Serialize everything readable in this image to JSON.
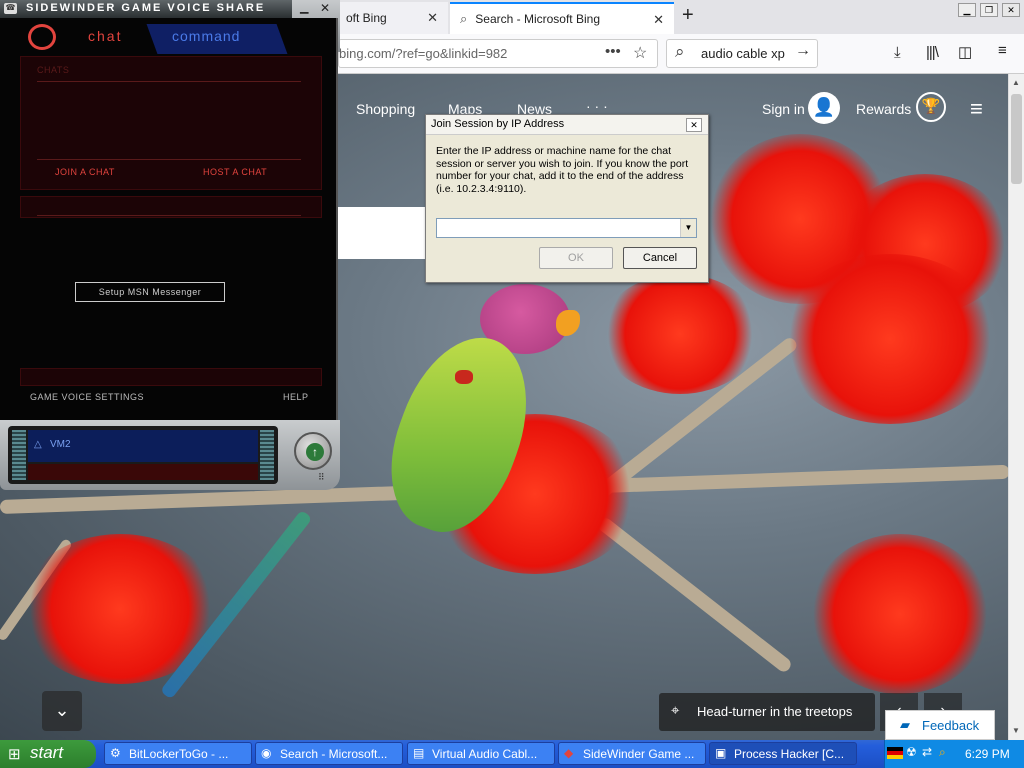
{
  "firefox": {
    "tabs": [
      {
        "label": "oft Bing"
      },
      {
        "label": "Search - Microsoft Bing"
      }
    ],
    "new_tab": "+",
    "url": "bing.com/?ref=go&linkid=982",
    "search_value": "audio cable xp"
  },
  "bing": {
    "nav": [
      "Shopping",
      "Maps",
      "News",
      "· · ·"
    ],
    "sign_in": "Sign in",
    "rewards": "Rewards",
    "caption": "Head-turner in the treetops",
    "feedback": "Feedback"
  },
  "sidewinder": {
    "title": "SIDEWINDER GAME VOICE SHARE",
    "tab_chat": "chat",
    "tab_command": "command",
    "chats_label": "CHATS",
    "join": "JOIN A CHAT",
    "host": "HOST A CHAT",
    "msn": "Setup MSN Messenger",
    "settings": "GAME VOICE SETTINGS",
    "help": "HELP",
    "channel": "VM2"
  },
  "dialog": {
    "title": "Join Session by IP Address",
    "message": "Enter the IP address or machine name for the chat session or server you wish to join. If you know the port number for your chat, add it to the end of the address (i.e. 10.2.3.4:9110).",
    "input_value": "",
    "ok": "OK",
    "cancel": "Cancel"
  },
  "taskbar": {
    "start": "start",
    "tasks": [
      {
        "label": "BitLockerToGo - ..."
      },
      {
        "label": "Search - Microsoft..."
      },
      {
        "label": "Virtual Audio Cabl..."
      },
      {
        "label": "SideWinder Game ..."
      },
      {
        "label": "Process Hacker [C..."
      }
    ],
    "clock": "6:29 PM"
  }
}
